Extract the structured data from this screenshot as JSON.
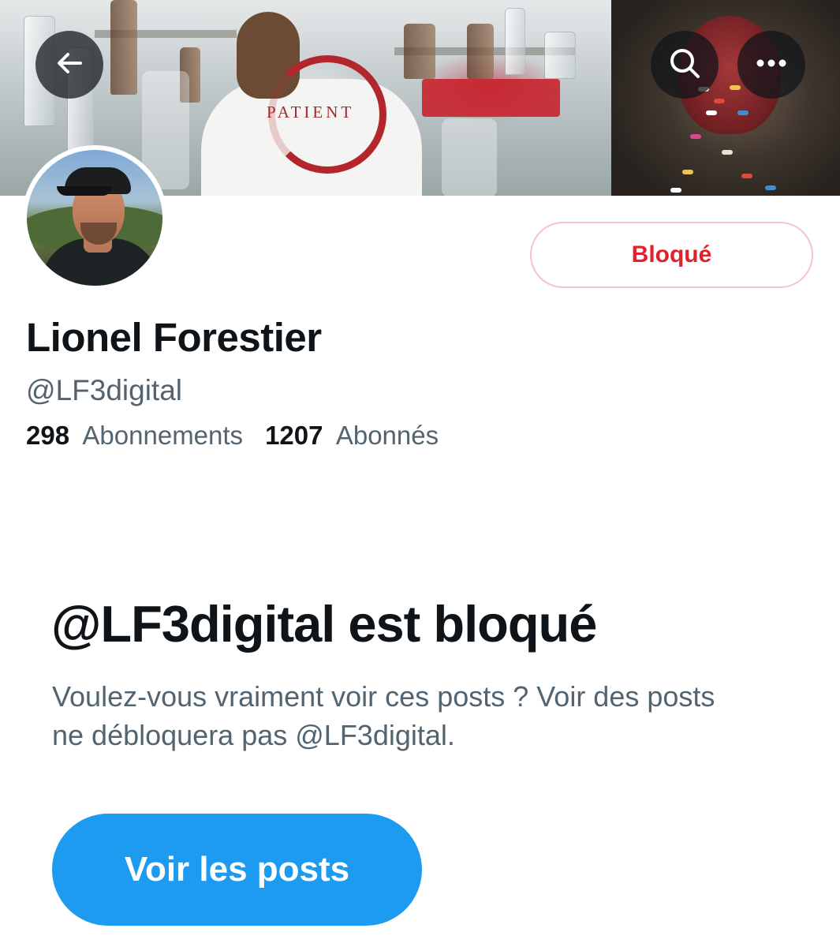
{
  "banner": {
    "logo_text": "PATIENT"
  },
  "icons": {
    "back": "arrow-left-icon",
    "search": "search-icon",
    "more": "more-horizontal-icon"
  },
  "profile": {
    "name": "Lionel Forestier",
    "handle": "@LF3digital",
    "following_count": "298",
    "following_label": "Abonnements",
    "followers_count": "1207",
    "followers_label": "Abonnés",
    "blocked_button_label": "Bloqué"
  },
  "blocked_notice": {
    "title": "@LF3digital est bloqué",
    "description": "Voulez-vous vraiment voir ces posts ? Voir des posts ne débloquera pas @LF3digital.",
    "view_posts_label": "Voir les posts"
  },
  "colors": {
    "accent": "#1d9bf0",
    "blocked_red": "#e0222f",
    "secondary_text": "#536471",
    "primary_text": "#0f1419"
  }
}
